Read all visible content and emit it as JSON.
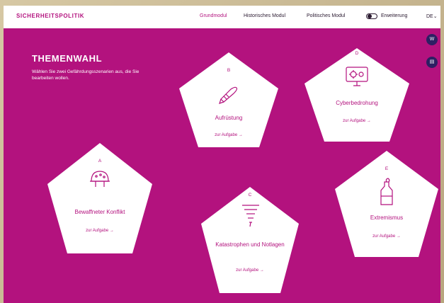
{
  "header": {
    "brand": "SICHERHEITSPOLITIK",
    "nav": [
      "Grundmodul",
      "Historisches Modul",
      "Politisches Modul"
    ],
    "toggle_label": "Erweiterung",
    "language": "DE",
    "language_chevron": "⌄"
  },
  "side_buttons": [
    "W",
    "▤"
  ],
  "main": {
    "title": "THEMENWAHL",
    "intro": "Wählen Sie zwei Gefährdungsszenarien aus, die Sie bearbeiten wollen."
  },
  "cards": [
    {
      "letter": "A",
      "title": "Bewaffneter Konflikt",
      "link": "zur Aufgabe",
      "icon": "helmet-icon"
    },
    {
      "letter": "B",
      "title": "Aufrüstung",
      "link": "zur Aufgabe",
      "icon": "missile-icon"
    },
    {
      "letter": "C",
      "title": "Katastrophen und Notlagen",
      "link": "zur Aufgabe",
      "icon": "tornado-icon"
    },
    {
      "letter": "D",
      "title": "Cyberbedrohung",
      "link": "zur Aufgabe",
      "icon": "virus-monitor-icon"
    },
    {
      "letter": "E",
      "title": "Extremismus",
      "link": "zur Aufgabe",
      "icon": "molotov-icon"
    }
  ],
  "colors": {
    "accent": "#b3127e",
    "card": "#ffffff",
    "dark": "#2d1f63"
  }
}
